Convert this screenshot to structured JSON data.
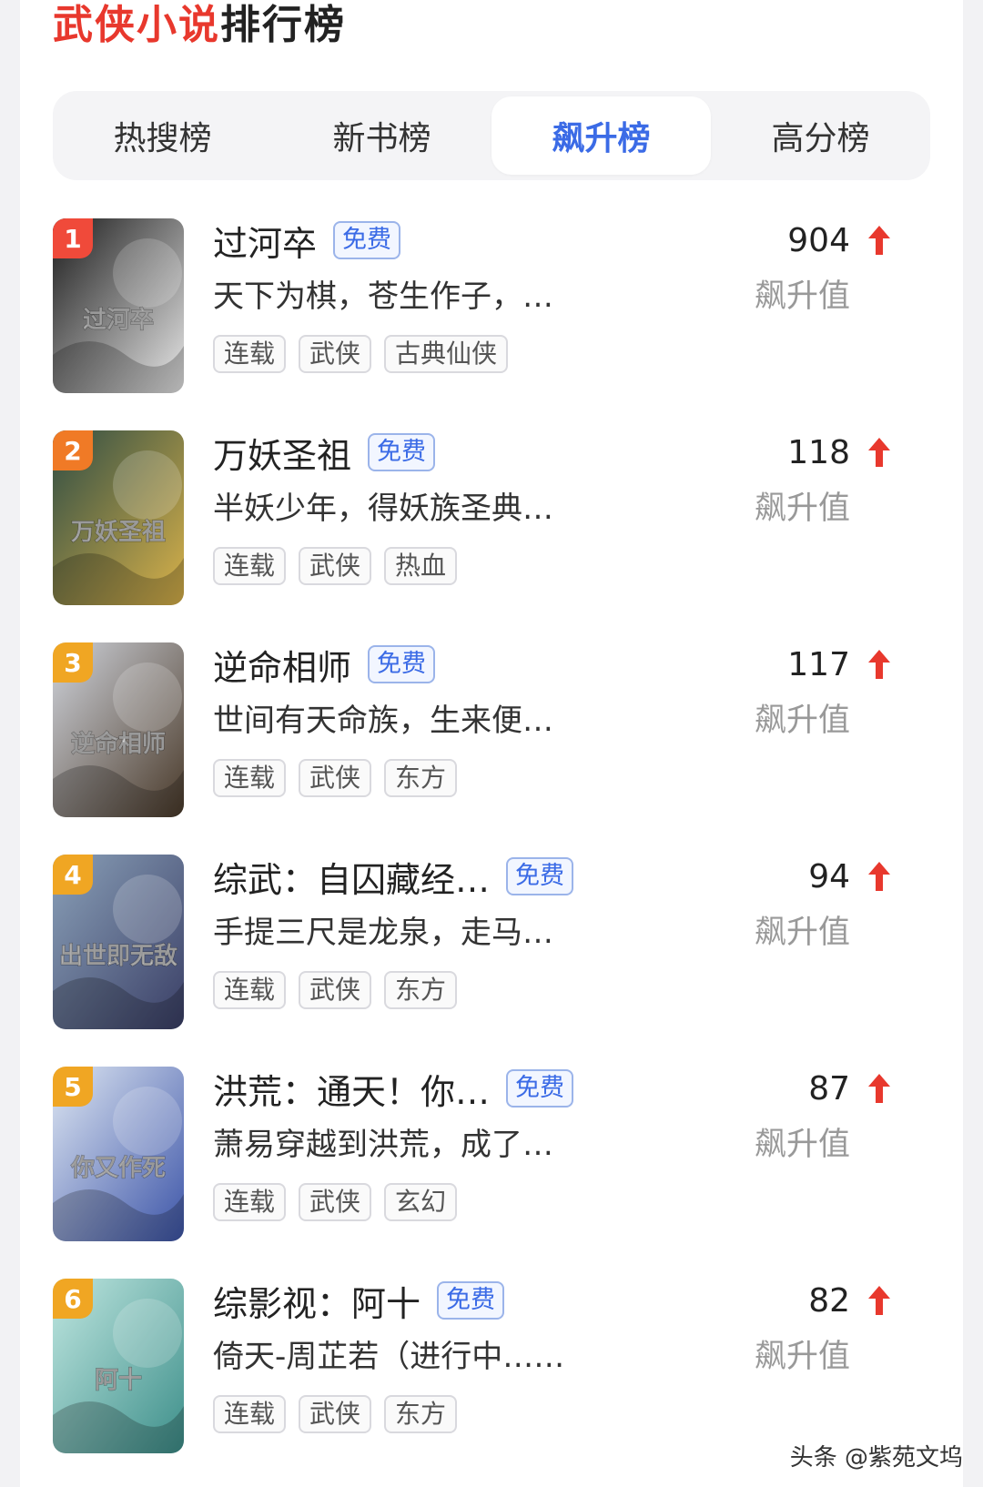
{
  "header": {
    "title_accent": "武侠小说",
    "title_rest": "排行榜"
  },
  "tabs": [
    {
      "label": "热搜榜",
      "active": false
    },
    {
      "label": "新书榜",
      "active": false
    },
    {
      "label": "飙升榜",
      "active": true
    },
    {
      "label": "高分榜",
      "active": false
    }
  ],
  "rank_colors": [
    "#f04a3a",
    "#f07a26",
    "#f0a623",
    "#f0a623",
    "#f0a623",
    "#f0a623"
  ],
  "arrow_color": "#e8382d",
  "books": [
    {
      "rank": "1",
      "title": "过河卒",
      "badge": "免费",
      "desc": "天下为棋，苍生作子，…",
      "tags": [
        "连载",
        "武侠",
        "古典仙侠"
      ],
      "score": "904",
      "score_label": "飙升值",
      "cover_colors": [
        "#1c1c1c",
        "#e8e8e8"
      ],
      "cover_text": "过河卒"
    },
    {
      "rank": "2",
      "title": "万妖圣祖",
      "badge": "免费",
      "desc": "半妖少年，得妖族圣典…",
      "tags": [
        "连载",
        "武侠",
        "热血"
      ],
      "score": "118",
      "score_label": "飙升值",
      "cover_colors": [
        "#2f4d44",
        "#d9b24a"
      ],
      "cover_text": "万妖圣祖"
    },
    {
      "rank": "3",
      "title": "逆命相师",
      "badge": "免费",
      "desc": "世间有天命族，生来便…",
      "tags": [
        "连载",
        "武侠",
        "东方"
      ],
      "score": "117",
      "score_label": "飙升值",
      "cover_colors": [
        "#cfd3db",
        "#4a3a2a"
      ],
      "cover_text": "逆命相师"
    },
    {
      "rank": "4",
      "title": "综武：自囚藏经…",
      "badge": "免费",
      "desc": "手提三尺是龙泉，走马…",
      "tags": [
        "连载",
        "武侠",
        "东方"
      ],
      "score": "94",
      "score_label": "飙升值",
      "cover_colors": [
        "#8aa0b8",
        "#3a3f66"
      ],
      "cover_text": "出世即无敌"
    },
    {
      "rank": "5",
      "title": "洪荒：通天！你…",
      "badge": "免费",
      "desc": "萧易穿越到洪荒，成了…",
      "tags": [
        "连载",
        "武侠",
        "玄幻"
      ],
      "score": "87",
      "score_label": "飙升值",
      "cover_colors": [
        "#dde6f2",
        "#3d55a8"
      ],
      "cover_text": "你又作死"
    },
    {
      "rank": "6",
      "title": "综影视：阿十",
      "badge": "免费",
      "desc": "倚天-周芷若（进行中……",
      "tags": [
        "连载",
        "武侠",
        "东方"
      ],
      "score": "82",
      "score_label": "飙升值",
      "cover_colors": [
        "#bfe6e0",
        "#3d8f8a"
      ],
      "cover_text": "阿十"
    }
  ],
  "watermark": "头条 @紫苑文坞"
}
